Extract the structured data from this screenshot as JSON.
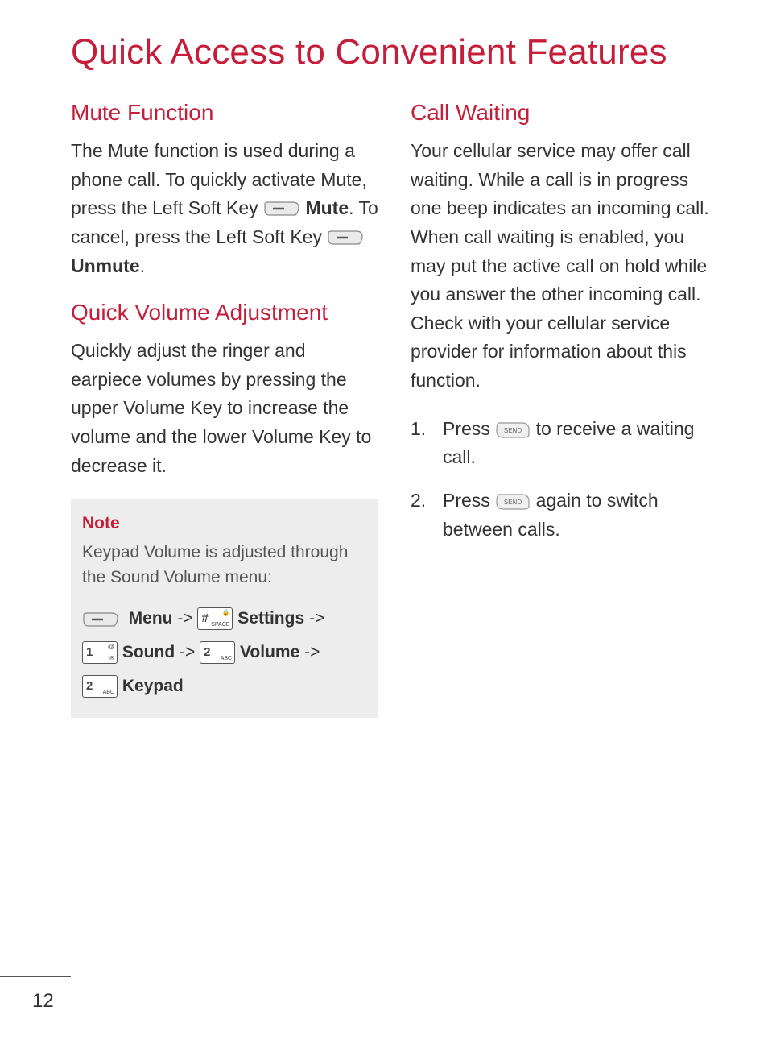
{
  "page_title": "Quick Access to Convenient Features",
  "page_number": "12",
  "left": {
    "mute": {
      "heading": "Mute Function",
      "p1a": "The Mute function is used during a phone call. To quickly activate Mute, press the Left Soft Key ",
      "mute_label": "Mute",
      "p1b": ". To cancel, press the Left Soft Key ",
      "unmute_label": "Unmute",
      "p1c": "."
    },
    "volume": {
      "heading": "Quick Volume Adjustment",
      "body": "Quickly adjust the ringer and earpiece volumes by pressing the upper Volume Key to increase the volume and the lower Volume Key to decrease it."
    },
    "note": {
      "label": "Note",
      "body": "Keypad Volume is adjusted through the Sound Volume menu:",
      "seq": {
        "menu": "Menu",
        "settings": "Settings",
        "sound": "Sound",
        "volume": "Volume",
        "keypad": "Keypad",
        "arrow": " -> "
      },
      "keys": {
        "hash_main": "#",
        "hash_sub": "🔒\nSPACE",
        "one_main": "1",
        "one_sub": "@\n✉",
        "two_main": "2",
        "two_sub": "ABC"
      }
    }
  },
  "right": {
    "cw": {
      "heading": "Call Waiting",
      "body": "Your cellular service may offer call waiting. While a call is in progress one beep indicates an incoming call. When call waiting is enabled, you may put the active call on hold while you answer the other incoming call. Check with your cellular service provider for information about this function.",
      "step1a": "Press ",
      "step1b": " to receive a waiting call.",
      "step2a": "Press ",
      "step2b": " again to switch between calls.",
      "send_label": "SEND"
    }
  }
}
